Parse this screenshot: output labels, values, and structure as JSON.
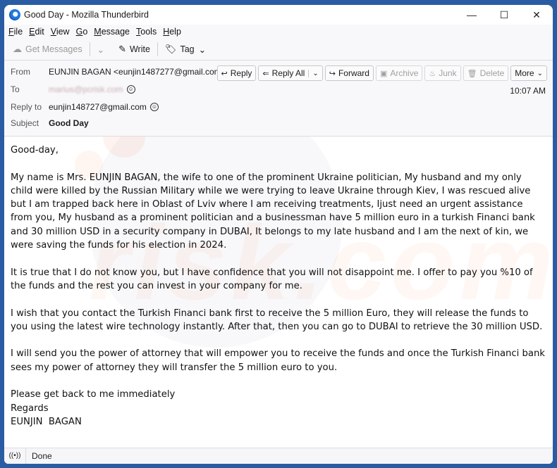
{
  "window": {
    "title": "Good Day - Mozilla Thunderbird",
    "controls": {
      "minimize": "—",
      "maximize": "☐",
      "close": "✕"
    }
  },
  "menubar": {
    "items": [
      {
        "label": "File",
        "accel": "F",
        "rest": "ile"
      },
      {
        "label": "Edit",
        "accel": "E",
        "rest": "dit"
      },
      {
        "label": "View",
        "accel": "V",
        "rest": "iew"
      },
      {
        "label": "Go",
        "accel": "G",
        "rest": "o"
      },
      {
        "label": "Message",
        "accel": "M",
        "rest": "essage"
      },
      {
        "label": "Tools",
        "accel": "T",
        "rest": "ools"
      },
      {
        "label": "Help",
        "accel": "H",
        "rest": "elp"
      }
    ]
  },
  "toolbar": {
    "get_messages": "Get Messages",
    "write": "Write",
    "tag": "Tag"
  },
  "header": {
    "from_label": "From",
    "from_value": "EUNJIN BAGAN <eunjin1487277@gmail.com>",
    "to_label": "To",
    "to_value": "marius@pcrisk.com",
    "reply_to_label": "Reply to",
    "reply_to_value": "eunjin148727@gmail.com",
    "subject_label": "Subject",
    "subject_value": "Good Day",
    "time": "10:07 AM",
    "actions": {
      "reply": "Reply",
      "reply_all": "Reply All",
      "forward": "Forward",
      "archive": "Archive",
      "junk": "Junk",
      "delete": "Delete",
      "more": "More"
    }
  },
  "message": {
    "greeting": "Good-day,",
    "paragraphs": [
      "My name is Mrs. EUNJIN  BAGAN, the wife to one of the prominent Ukraine politician, My husband and my only child were killed by the Russian Military while we were trying to leave Ukraine through Kiev, I was rescued alive but I am trapped back here in Oblast of Lviv where I am receiving treatments, Ijust need an urgent assistance from you, My husband as a prominent politician and a businessman have 5 million euro in a turkish Financi bank and 30 million USD in a security company in DUBAI, It belongs to my late husband and I am the next of kin, we were saving the funds for his election in 2024.",
      "It is true that I do not know you, but I have confidence that you will not disappoint me. I offer to pay you %10 of the funds and the rest you can invest in your company for me.",
      "I wish that you contact the Turkish Financi bank first to receive the 5 million Euro, they will release the funds to you using the latest wire technology instantly. After that, then you can go to DUBAI to retrieve the 30 million USD.",
      "I will send you the power of attorney that will empower you to receive the funds and once the Turkish Financi bank sees my power of attorney they will transfer the 5 million euro to you."
    ],
    "closing": [
      "Please get back to me immediately",
      "Regards",
      "EUNJIN  BAGAN"
    ],
    "watermark": "risk.com"
  },
  "statusbar": {
    "icon": "((•))",
    "text": "Done"
  }
}
